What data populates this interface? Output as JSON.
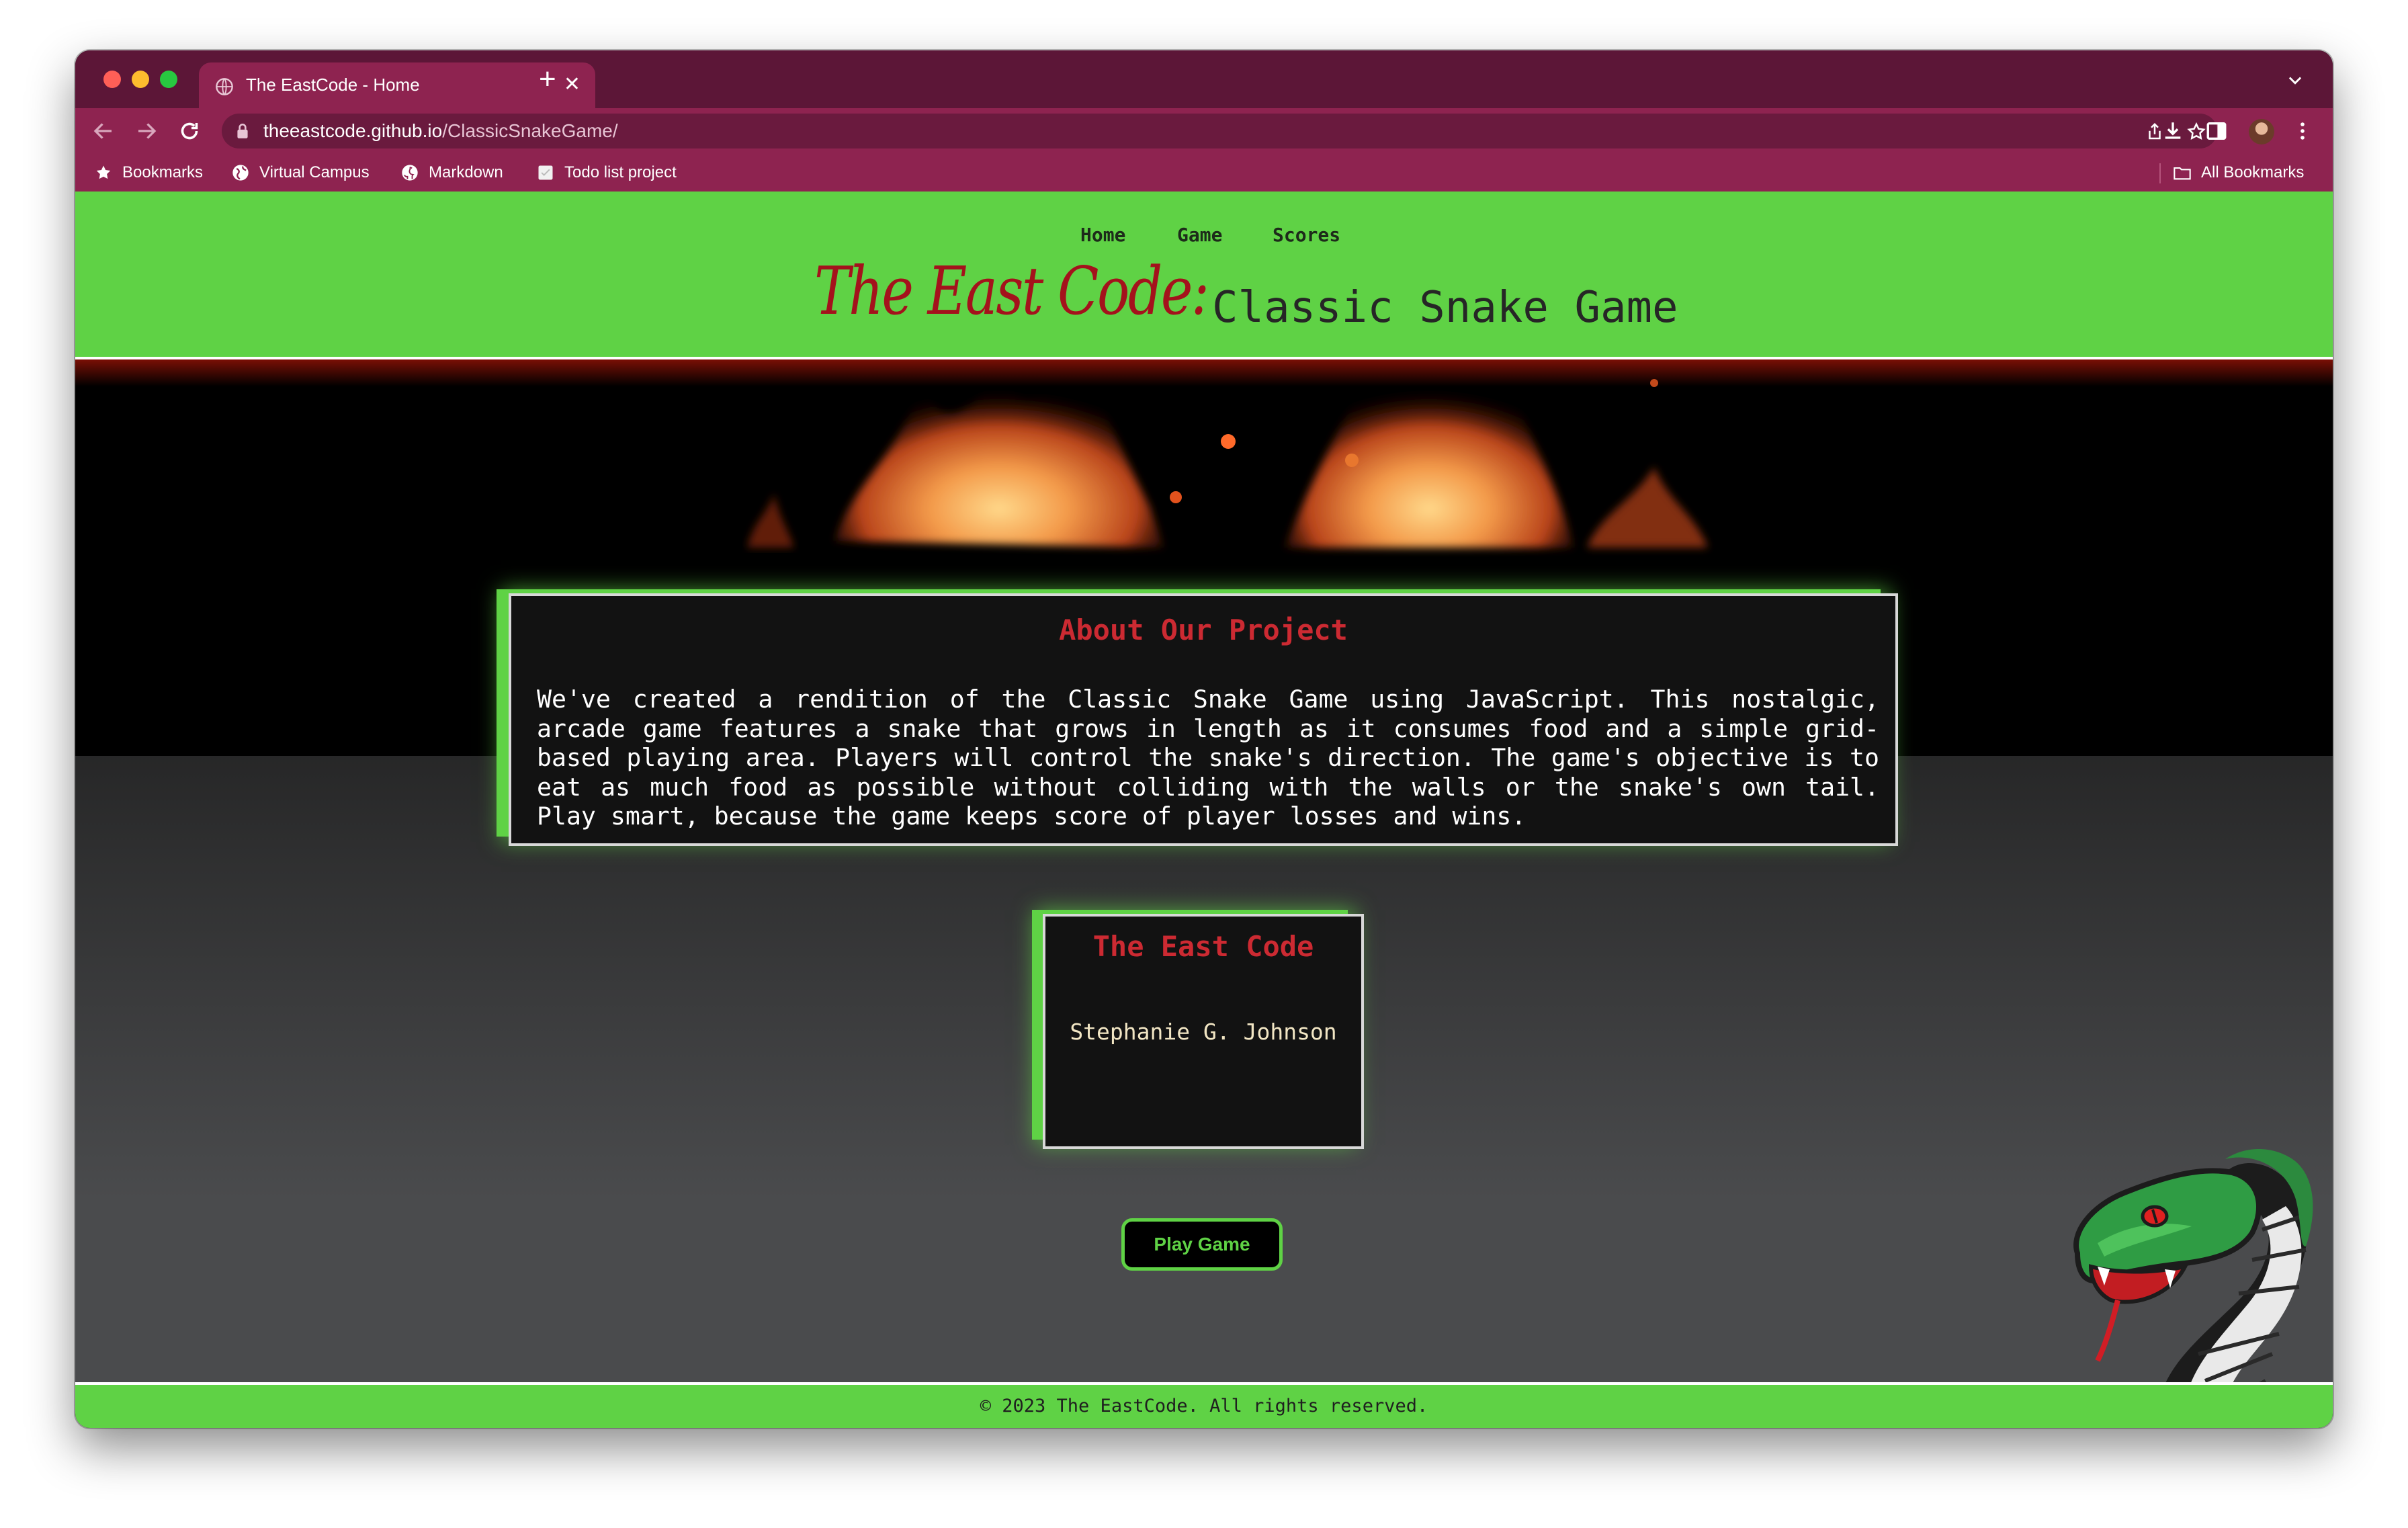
{
  "browser": {
    "tab_title": "The EastCode - Home",
    "new_tab_label": "+",
    "tab_close_label": "✕",
    "url_host": "theeastcode.github.io",
    "url_path": "/ClassicSnakeGame/",
    "bookmarks": [
      {
        "label": "Bookmarks",
        "icon": "star-icon"
      },
      {
        "label": "Virtual Campus",
        "icon": "globe-icon"
      },
      {
        "label": "Markdown",
        "icon": "github-icon"
      },
      {
        "label": "Todo list project",
        "icon": "page-icon"
      }
    ],
    "all_bookmarks_label": "All Bookmarks"
  },
  "header": {
    "nav": [
      "Home",
      "Game",
      "Scores"
    ],
    "brand": "The East Code:",
    "subtitle": "Classic Snake Game"
  },
  "about": {
    "title": "About Our Project",
    "text": "We've created a rendition of the Classic Snake Game using JavaScript. This nostalgic, arcade game features a snake that grows in length as it consumes food and a simple grid-based playing area. Players will control the snake's direction. The game's objective is to eat as much food as possible without colliding with the walls or the snake's own tail. Play smart, because the game keeps score of player losses and wins."
  },
  "team": {
    "title": "The East Code",
    "member": "Stephanie G. Johnson"
  },
  "play_button": "Play Game",
  "footer": "© 2023 The EastCode. All rights reserved.",
  "colors": {
    "chrome": "#8e2350",
    "titlebar": "#5c1637",
    "header_green": "#5fd245",
    "heading_red": "#cc2a32",
    "brand_red": "#a4121c"
  }
}
